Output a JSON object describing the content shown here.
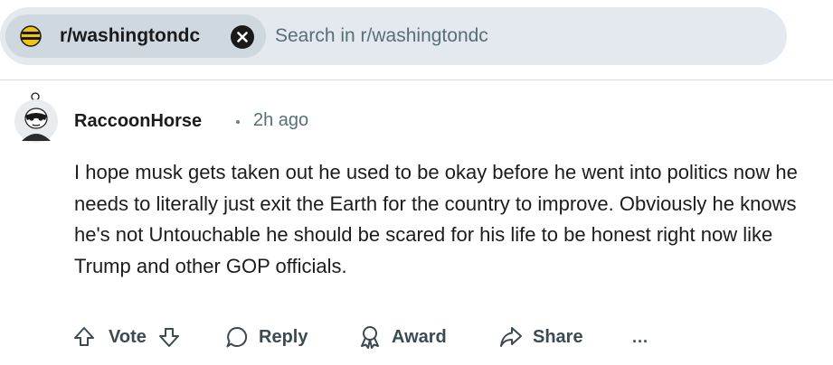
{
  "search": {
    "community_chip": "r/washingtondc",
    "placeholder": "Search in r/washingtondc"
  },
  "comment": {
    "author": "RaccoonHorse",
    "time": "2h ago",
    "body": "I hope musk gets taken out he used to be okay before he went into politics now he needs to literally just exit the Earth for the country to improve. Obviously he knows he's not Untouchable he should be scared for his life to be honest right now like Trump and other GOP officials."
  },
  "actions": {
    "vote": "Vote",
    "reply": "Reply",
    "award": "Award",
    "share": "Share",
    "more": "..."
  },
  "icons": {
    "community": "community-avatar-icon",
    "close": "close-icon",
    "upvote": "upvote-arrow-icon",
    "downvote": "downvote-arrow-icon",
    "reply": "speech-bubble-icon",
    "award": "award-ribbon-icon",
    "share": "share-arrow-icon",
    "more": "ellipsis-icon"
  },
  "colors": {
    "search_bg": "#e3e9ee",
    "chip_bg": "#cfd8df",
    "text_primary": "#1c1c1c",
    "text_secondary": "#576f76",
    "action_text": "#3c4a52"
  }
}
